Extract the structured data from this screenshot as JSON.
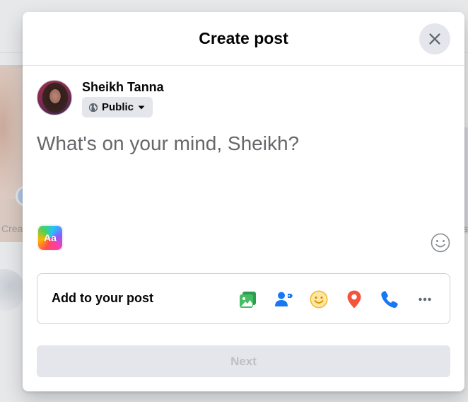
{
  "dialog": {
    "title": "Create post",
    "close_icon": "close-icon"
  },
  "author": {
    "name": "Sheikh Tanna",
    "privacy": {
      "label": "Public",
      "icon": "globe-icon"
    }
  },
  "composer": {
    "placeholder": "What's on your mind, Sheikh?",
    "background_picker_label": "Aa"
  },
  "add_to_post": {
    "label": "Add to your post",
    "icons": [
      {
        "name": "photo-video-icon",
        "color": "#45bd62"
      },
      {
        "name": "tag-people-icon",
        "color": "#1877f2"
      },
      {
        "name": "feeling-activity-icon",
        "color": "#f7b928"
      },
      {
        "name": "check-in-icon",
        "color": "#f5533d"
      },
      {
        "name": "call-icon",
        "color": "#1877f2"
      },
      {
        "name": "more-icon",
        "color": "#606770"
      }
    ]
  },
  "next_button": {
    "label": "Next",
    "enabled": false
  },
  "background_page": {
    "left_text": "Crea",
    "right_text": "s"
  },
  "colors": {
    "accent": "#1877f2",
    "button_bg": "#e4e6eb",
    "disabled_text": "#bcc0c4",
    "placeholder_text": "#65676b"
  }
}
